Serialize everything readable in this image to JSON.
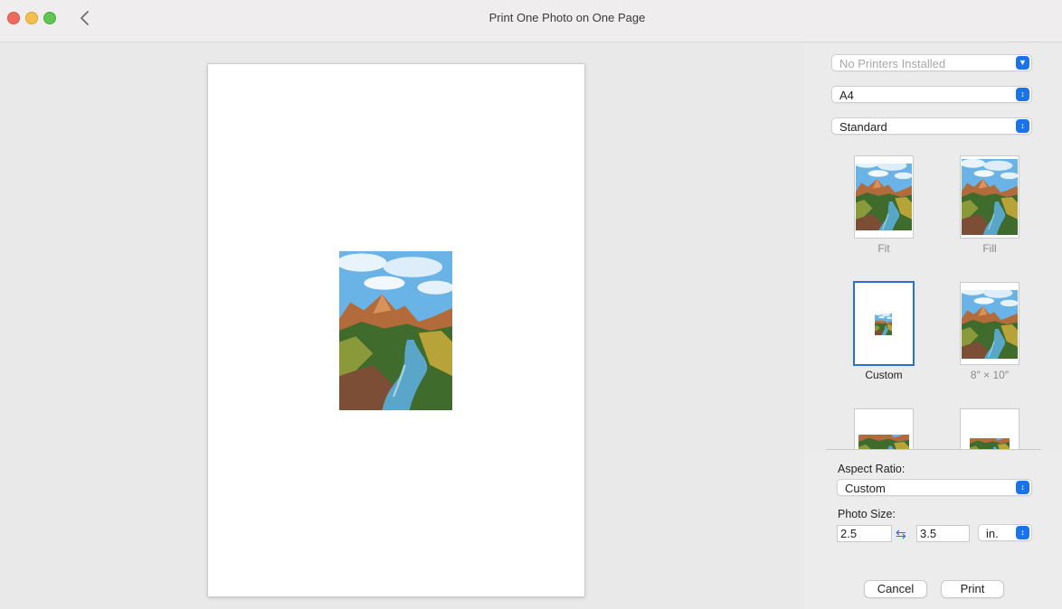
{
  "window": {
    "title": "Print One Photo on One Page"
  },
  "printer": {
    "value": "No Printers Installed"
  },
  "paper_size": {
    "value": "A4"
  },
  "quality": {
    "value": "Standard"
  },
  "layouts": [
    {
      "label": "Fit"
    },
    {
      "label": "Fill"
    },
    {
      "label": "Custom",
      "selected": true
    },
    {
      "label": "8″ × 10″"
    }
  ],
  "aspect_ratio": {
    "label": "Aspect Ratio:",
    "value": "Custom"
  },
  "photo_size": {
    "label": "Photo Size:",
    "width": "2.5",
    "height": "3.5",
    "unit": "in."
  },
  "buttons": {
    "cancel": "Cancel",
    "print": "Print"
  },
  "colors": {
    "accent": "#1a73e8",
    "selection": "#2a6fd5"
  }
}
